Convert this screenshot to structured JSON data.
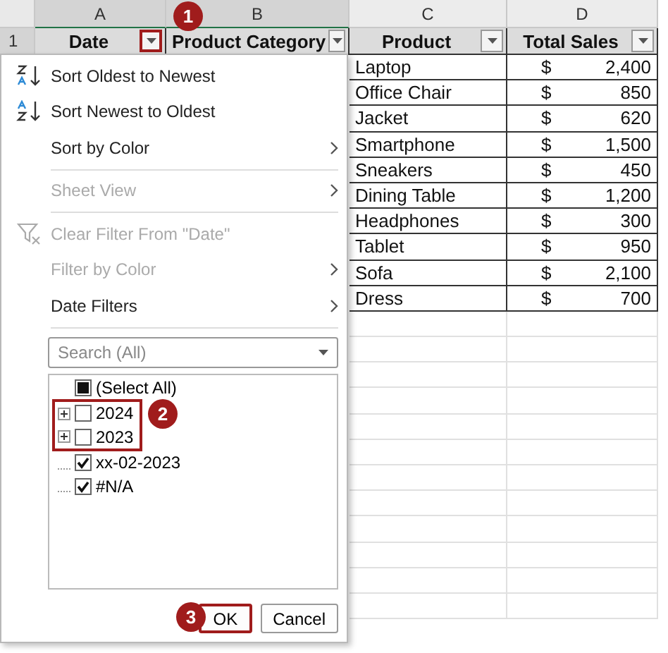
{
  "column_headers": [
    {
      "label": "A",
      "selected": true
    },
    {
      "label": "B",
      "selected": true
    },
    {
      "label": "C",
      "selected": false
    },
    {
      "label": "D",
      "selected": false
    }
  ],
  "row_number": "1",
  "header_row": [
    {
      "label": "Date",
      "highlighted": true
    },
    {
      "label": "Product Category",
      "highlighted": false
    },
    {
      "label": "Product",
      "highlighted": false
    },
    {
      "label": "Total Sales",
      "highlighted": false
    }
  ],
  "rows": [
    {
      "product": "Laptop",
      "currency": "$",
      "sales": "2,400"
    },
    {
      "product": "Office Chair",
      "currency": "$",
      "sales": "850"
    },
    {
      "product": "Jacket",
      "currency": "$",
      "sales": "620"
    },
    {
      "product": "Smartphone",
      "currency": "$",
      "sales": "1,500"
    },
    {
      "product": "Sneakers",
      "currency": "$",
      "sales": "450"
    },
    {
      "product": "Dining Table",
      "currency": "$",
      "sales": "1,200"
    },
    {
      "product": "Headphones",
      "currency": "$",
      "sales": "300"
    },
    {
      "product": "Tablet",
      "currency": "$",
      "sales": "950"
    },
    {
      "product": "Sofa",
      "currency": "$",
      "sales": "2,100"
    },
    {
      "product": "Dress",
      "currency": "$",
      "sales": "700"
    }
  ],
  "filter_menu": {
    "items": [
      {
        "kind": "sort-asc",
        "label": "Sort Oldest to Newest",
        "disabled": false,
        "submenu": false
      },
      {
        "kind": "sort-desc",
        "label": "Sort Newest to Oldest",
        "disabled": false,
        "submenu": false
      },
      {
        "kind": "plain",
        "label": "Sort by Color",
        "disabled": false,
        "submenu": true
      },
      {
        "kind": "divider"
      },
      {
        "kind": "plain",
        "label": "Sheet View",
        "disabled": true,
        "submenu": true
      },
      {
        "kind": "divider"
      },
      {
        "kind": "clear",
        "label": "Clear Filter From \"Date\"",
        "disabled": true,
        "submenu": false
      },
      {
        "kind": "plain",
        "label": "Filter by Color",
        "disabled": true,
        "submenu": true
      },
      {
        "kind": "plain",
        "label": "Date Filters",
        "disabled": false,
        "submenu": true
      },
      {
        "kind": "divider"
      }
    ],
    "search": {
      "placeholder": "Search (All)"
    },
    "tree": [
      {
        "label": "(Select All)",
        "checked": false,
        "mixed": true,
        "expandable": false,
        "highlighted": false
      },
      {
        "label": "2024",
        "checked": false,
        "mixed": false,
        "expandable": true,
        "highlighted": true
      },
      {
        "label": "2023",
        "checked": false,
        "mixed": false,
        "expandable": true,
        "highlighted": true
      },
      {
        "label": "xx-02-2023",
        "checked": true,
        "mixed": false,
        "expandable": false,
        "highlighted": false
      },
      {
        "label": "#N/A",
        "checked": true,
        "mixed": false,
        "expandable": false,
        "highlighted": false
      }
    ],
    "buttons": [
      {
        "label": "OK",
        "highlighted": true
      },
      {
        "label": "Cancel",
        "highlighted": false
      }
    ]
  },
  "annotations": [
    {
      "number": "1"
    },
    {
      "number": "2"
    },
    {
      "number": "3"
    }
  ]
}
